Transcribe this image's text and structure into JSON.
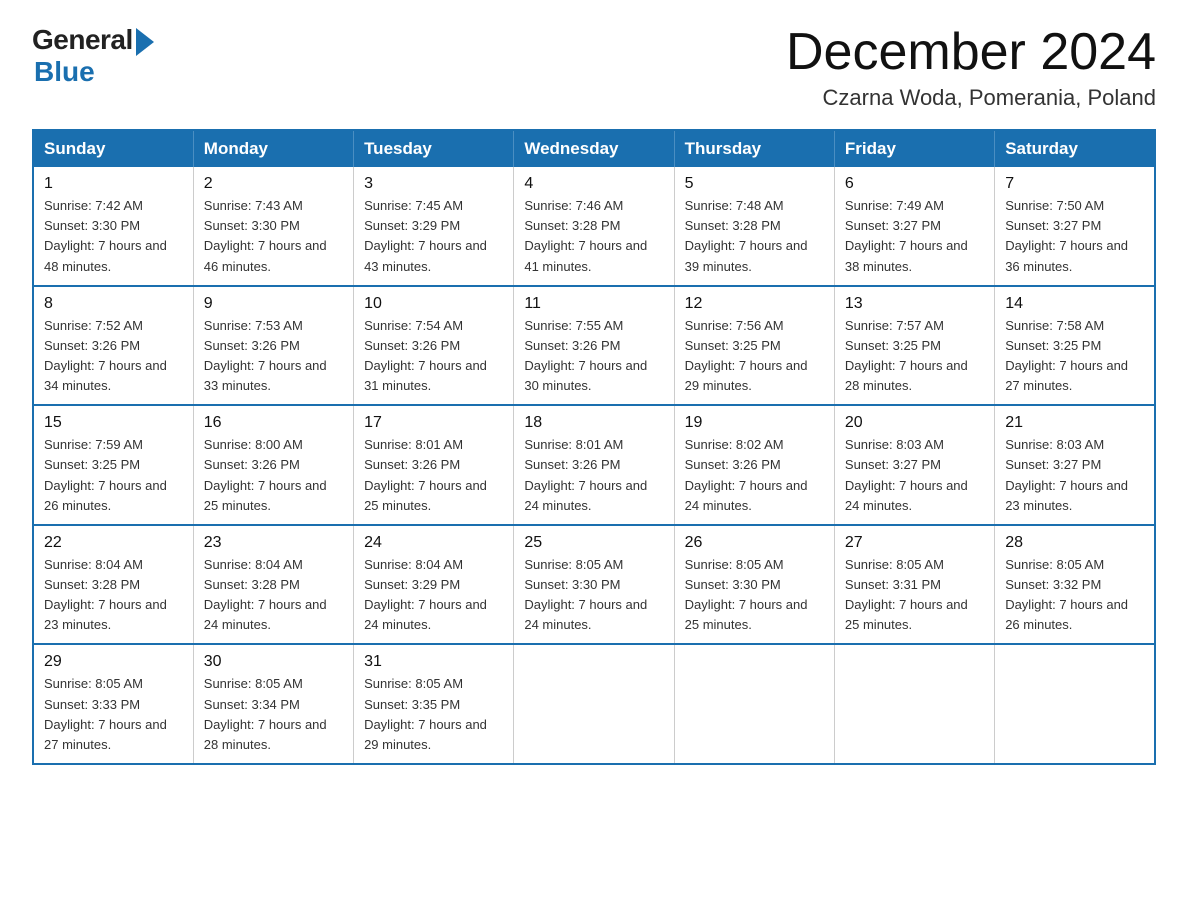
{
  "logo": {
    "general": "General",
    "blue": "Blue"
  },
  "header": {
    "month": "December 2024",
    "location": "Czarna Woda, Pomerania, Poland"
  },
  "weekdays": [
    "Sunday",
    "Monday",
    "Tuesday",
    "Wednesday",
    "Thursday",
    "Friday",
    "Saturday"
  ],
  "weeks": [
    [
      {
        "day": "1",
        "sunrise": "7:42 AM",
        "sunset": "3:30 PM",
        "daylight": "7 hours and 48 minutes."
      },
      {
        "day": "2",
        "sunrise": "7:43 AM",
        "sunset": "3:30 PM",
        "daylight": "7 hours and 46 minutes."
      },
      {
        "day": "3",
        "sunrise": "7:45 AM",
        "sunset": "3:29 PM",
        "daylight": "7 hours and 43 minutes."
      },
      {
        "day": "4",
        "sunrise": "7:46 AM",
        "sunset": "3:28 PM",
        "daylight": "7 hours and 41 minutes."
      },
      {
        "day": "5",
        "sunrise": "7:48 AM",
        "sunset": "3:28 PM",
        "daylight": "7 hours and 39 minutes."
      },
      {
        "day": "6",
        "sunrise": "7:49 AM",
        "sunset": "3:27 PM",
        "daylight": "7 hours and 38 minutes."
      },
      {
        "day": "7",
        "sunrise": "7:50 AM",
        "sunset": "3:27 PM",
        "daylight": "7 hours and 36 minutes."
      }
    ],
    [
      {
        "day": "8",
        "sunrise": "7:52 AM",
        "sunset": "3:26 PM",
        "daylight": "7 hours and 34 minutes."
      },
      {
        "day": "9",
        "sunrise": "7:53 AM",
        "sunset": "3:26 PM",
        "daylight": "7 hours and 33 minutes."
      },
      {
        "day": "10",
        "sunrise": "7:54 AM",
        "sunset": "3:26 PM",
        "daylight": "7 hours and 31 minutes."
      },
      {
        "day": "11",
        "sunrise": "7:55 AM",
        "sunset": "3:26 PM",
        "daylight": "7 hours and 30 minutes."
      },
      {
        "day": "12",
        "sunrise": "7:56 AM",
        "sunset": "3:25 PM",
        "daylight": "7 hours and 29 minutes."
      },
      {
        "day": "13",
        "sunrise": "7:57 AM",
        "sunset": "3:25 PM",
        "daylight": "7 hours and 28 minutes."
      },
      {
        "day": "14",
        "sunrise": "7:58 AM",
        "sunset": "3:25 PM",
        "daylight": "7 hours and 27 minutes."
      }
    ],
    [
      {
        "day": "15",
        "sunrise": "7:59 AM",
        "sunset": "3:25 PM",
        "daylight": "7 hours and 26 minutes."
      },
      {
        "day": "16",
        "sunrise": "8:00 AM",
        "sunset": "3:26 PM",
        "daylight": "7 hours and 25 minutes."
      },
      {
        "day": "17",
        "sunrise": "8:01 AM",
        "sunset": "3:26 PM",
        "daylight": "7 hours and 25 minutes."
      },
      {
        "day": "18",
        "sunrise": "8:01 AM",
        "sunset": "3:26 PM",
        "daylight": "7 hours and 24 minutes."
      },
      {
        "day": "19",
        "sunrise": "8:02 AM",
        "sunset": "3:26 PM",
        "daylight": "7 hours and 24 minutes."
      },
      {
        "day": "20",
        "sunrise": "8:03 AM",
        "sunset": "3:27 PM",
        "daylight": "7 hours and 24 minutes."
      },
      {
        "day": "21",
        "sunrise": "8:03 AM",
        "sunset": "3:27 PM",
        "daylight": "7 hours and 23 minutes."
      }
    ],
    [
      {
        "day": "22",
        "sunrise": "8:04 AM",
        "sunset": "3:28 PM",
        "daylight": "7 hours and 23 minutes."
      },
      {
        "day": "23",
        "sunrise": "8:04 AM",
        "sunset": "3:28 PM",
        "daylight": "7 hours and 24 minutes."
      },
      {
        "day": "24",
        "sunrise": "8:04 AM",
        "sunset": "3:29 PM",
        "daylight": "7 hours and 24 minutes."
      },
      {
        "day": "25",
        "sunrise": "8:05 AM",
        "sunset": "3:30 PM",
        "daylight": "7 hours and 24 minutes."
      },
      {
        "day": "26",
        "sunrise": "8:05 AM",
        "sunset": "3:30 PM",
        "daylight": "7 hours and 25 minutes."
      },
      {
        "day": "27",
        "sunrise": "8:05 AM",
        "sunset": "3:31 PM",
        "daylight": "7 hours and 25 minutes."
      },
      {
        "day": "28",
        "sunrise": "8:05 AM",
        "sunset": "3:32 PM",
        "daylight": "7 hours and 26 minutes."
      }
    ],
    [
      {
        "day": "29",
        "sunrise": "8:05 AM",
        "sunset": "3:33 PM",
        "daylight": "7 hours and 27 minutes."
      },
      {
        "day": "30",
        "sunrise": "8:05 AM",
        "sunset": "3:34 PM",
        "daylight": "7 hours and 28 minutes."
      },
      {
        "day": "31",
        "sunrise": "8:05 AM",
        "sunset": "3:35 PM",
        "daylight": "7 hours and 29 minutes."
      },
      null,
      null,
      null,
      null
    ]
  ],
  "labels": {
    "sunrise": "Sunrise:",
    "sunset": "Sunset:",
    "daylight": "Daylight:"
  }
}
